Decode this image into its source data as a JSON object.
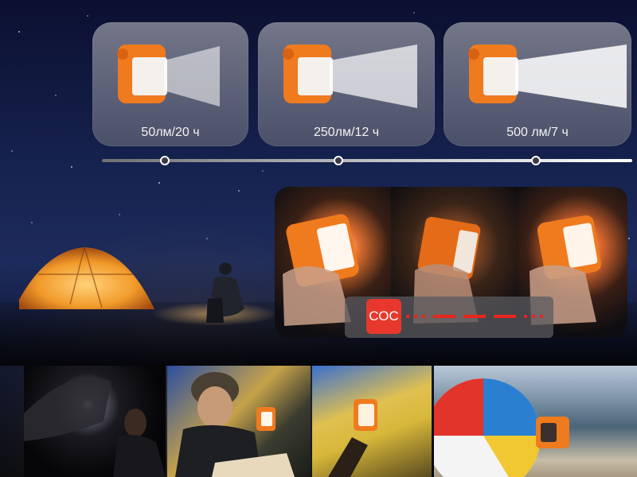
{
  "modes": [
    {
      "label": "50лм/20 ч"
    },
    {
      "label": "250лм/12 ч"
    },
    {
      "label": "500 лм/7 ч"
    }
  ],
  "slider": {
    "levels": [
      0.12,
      0.45,
      0.85
    ]
  },
  "sos": {
    "badge": "СОС",
    "signal_color": "#e8261c"
  },
  "colors": {
    "lamp_orange": "#f07a1e",
    "sos_red": "#e8382d",
    "night_sky": "#16224f"
  },
  "icons": [
    "lamp-icon",
    "tent-icon",
    "camper-icon"
  ]
}
